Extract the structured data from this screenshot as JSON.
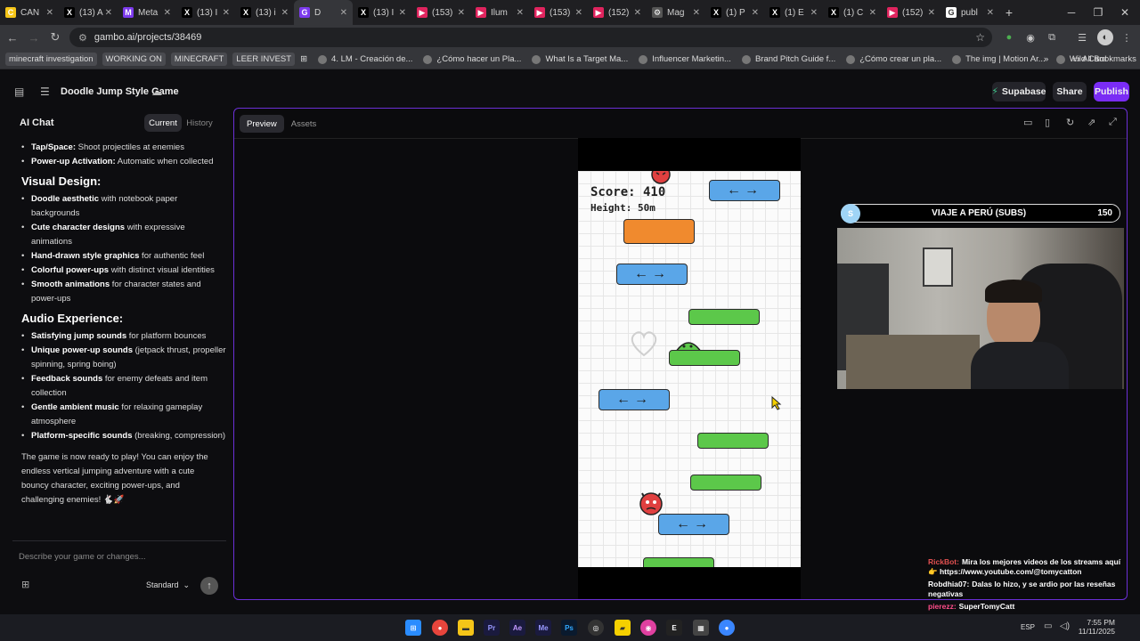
{
  "browser": {
    "tabs": [
      {
        "title": "CAN",
        "icon": "canva-icon",
        "color": "#f5c518",
        "glyph": "C"
      },
      {
        "title": "(13) A",
        "icon": "x-icon",
        "color": "#000000",
        "glyph": "X"
      },
      {
        "title": "Meta",
        "icon": "meta-icon",
        "color": "#7c3aed",
        "glyph": "M"
      },
      {
        "title": "(13) I",
        "icon": "x-icon",
        "color": "#000000",
        "glyph": "X"
      },
      {
        "title": "(13) i",
        "icon": "x-icon",
        "color": "#000000",
        "glyph": "X"
      },
      {
        "title": "D",
        "icon": "gambo-icon",
        "color": "#7c3aed",
        "glyph": "G"
      },
      {
        "title": "(13) I",
        "icon": "x-icon",
        "color": "#000000",
        "glyph": "X"
      },
      {
        "title": "(153)",
        "icon": "youtube-icon",
        "color": "#e0245e",
        "glyph": "▶"
      },
      {
        "title": "Ilum",
        "icon": "youtube-icon",
        "color": "#e0245e",
        "glyph": "▶"
      },
      {
        "title": "(153)",
        "icon": "youtube-icon",
        "color": "#e0245e",
        "glyph": "▶"
      },
      {
        "title": "(152)",
        "icon": "youtube-icon",
        "color": "#e0245e",
        "glyph": "▶"
      },
      {
        "title": "Mag",
        "icon": "gear-icon",
        "color": "#555555",
        "glyph": "⚙"
      },
      {
        "title": "(1) P",
        "icon": "x-icon",
        "color": "#000000",
        "glyph": "X"
      },
      {
        "title": "(1) E",
        "icon": "x-icon",
        "color": "#000000",
        "glyph": "X"
      },
      {
        "title": "(1) C",
        "icon": "x-icon",
        "color": "#000000",
        "glyph": "X"
      },
      {
        "title": "(152)",
        "icon": "youtube-icon",
        "color": "#e0245e",
        "glyph": "▶"
      },
      {
        "title": "publ",
        "icon": "google-icon",
        "color": "#ffffff",
        "glyph": "G"
      }
    ],
    "url": "gambo.ai/projects/38469",
    "bookmarks": [
      {
        "label": "minecraft investigation",
        "tag": true
      },
      {
        "label": "WORKING ON",
        "tag": true
      },
      {
        "label": "MINECRAFT",
        "tag": true
      },
      {
        "label": "LEER INVEST",
        "tag": true
      },
      {
        "label": "4. LM - Creación de...",
        "tag": false
      },
      {
        "label": "¿Cómo hacer un Pla...",
        "tag": false
      },
      {
        "label": "What Is a Target Ma...",
        "tag": false
      },
      {
        "label": "Influencer Marketin...",
        "tag": false
      },
      {
        "label": "Brand Pitch Guide f...",
        "tag": false
      },
      {
        "label": "¿Cómo crear un pla...",
        "tag": false
      },
      {
        "label": "The img | Motion Ar...",
        "tag": false
      },
      {
        "label": "Wild Card",
        "tag": false
      }
    ],
    "all_bookmarks": "All Bookmarks"
  },
  "app": {
    "project_title": "Doodle Jump Style Game",
    "supabase": "Supabase",
    "share": "Share",
    "publish": "Publish"
  },
  "chat": {
    "title": "AI Chat",
    "tab_current": "Current",
    "tab_history": "History",
    "list1": [
      {
        "b": "Tap/Space:",
        "t": " Shoot projectiles at enemies"
      },
      {
        "b": "Power-up Activation:",
        "t": " Automatic when collected"
      }
    ],
    "heading_visual": "Visual Design:",
    "list2": [
      {
        "b": "Doodle aesthetic",
        "t": " with notebook paper backgrounds"
      },
      {
        "b": "Cute character designs",
        "t": " with expressive animations"
      },
      {
        "b": "Hand-drawn style graphics",
        "t": " for authentic feel"
      },
      {
        "b": "Colorful power-ups",
        "t": " with distinct visual identities"
      },
      {
        "b": "Smooth animations",
        "t": " for character states and power-ups"
      }
    ],
    "heading_audio": "Audio Experience:",
    "list3": [
      {
        "b": "Satisfying jump sounds",
        "t": " for platform bounces"
      },
      {
        "b": "Unique power-up sounds",
        "t": " (jetpack thrust, propeller spinning, spring boing)"
      },
      {
        "b": "Feedback sounds",
        "t": " for enemy defeats and item collection"
      },
      {
        "b": "Gentle ambient music",
        "t": " for relaxing gameplay atmosphere"
      },
      {
        "b": "Platform-specific sounds",
        "t": " (breaking, compression)"
      }
    ],
    "closing": "The game is now ready to play! You can enjoy the endless vertical jumping adventure with a cute bouncy character, exciting power-ups, and challenging enemies! 🐇🚀",
    "input_placeholder": "Describe your game or changes...",
    "mode": "Standard"
  },
  "preview": {
    "tab_preview": "Preview",
    "tab_assets": "Assets"
  },
  "game": {
    "score": "Score: 410",
    "height": "Height: 50m",
    "arrow_label": "←→"
  },
  "stream": {
    "subs_label": "VIAJE A PERÚ (SUBS)",
    "subs_count": "150",
    "subs_progress": 0.05,
    "chat": [
      {
        "user": "RickBot:",
        "msg": "Mira los mejores videos de los streams aquí👉 https://www.youtube.com/@tomycatton",
        "color": "#e05050"
      },
      {
        "user": "Robdhia07:",
        "msg": "Dalas lo hizo, y se ardio por las reseñas negativas",
        "color": "#ffffff"
      },
      {
        "user": "pierezz:",
        "msg": "SuperTomyCatt",
        "color": "#ff4d8a"
      }
    ]
  },
  "taskbar": {
    "time": "7:55 PM",
    "date": "11/11/2025",
    "lang": "ESP"
  }
}
